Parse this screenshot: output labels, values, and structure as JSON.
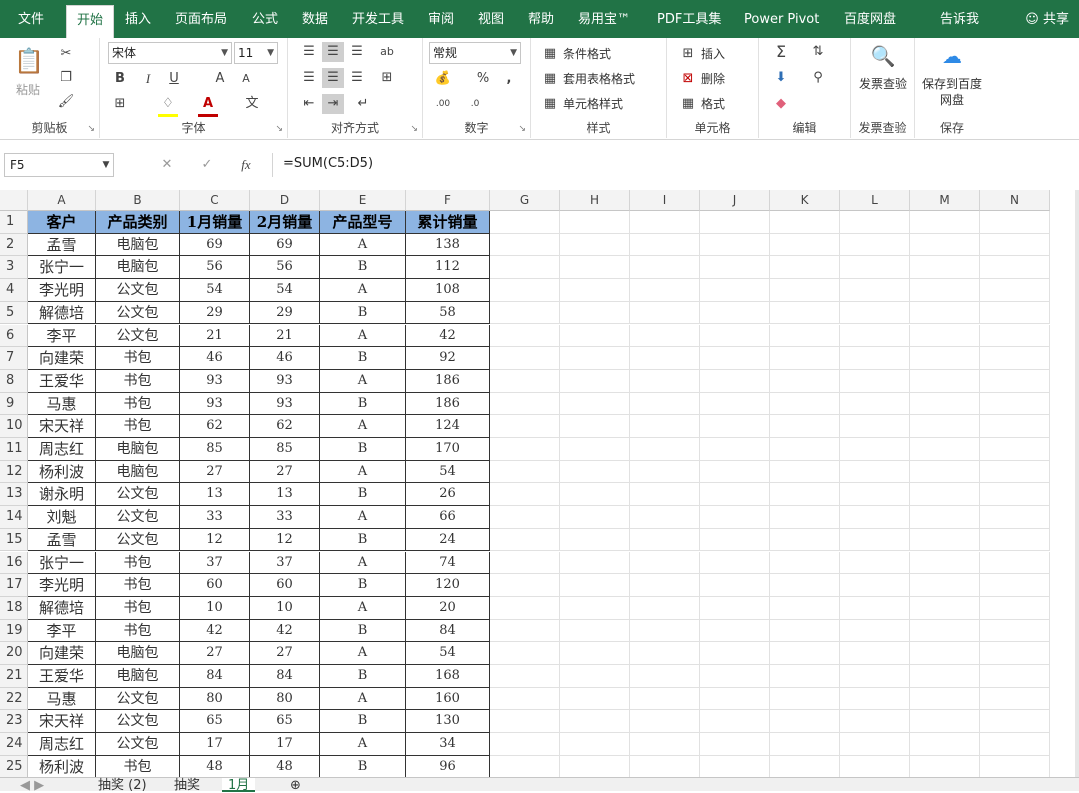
{
  "menu": {
    "tabs": [
      "文件",
      "开始",
      "插入",
      "页面布局",
      "公式",
      "数据",
      "开发工具",
      "审阅",
      "视图",
      "帮助",
      "易用宝™",
      "PDF工具集",
      "Power Pivot",
      "百度网盘",
      "告诉我"
    ],
    "active": "开始",
    "share": "共享"
  },
  "ribbon": {
    "clipboard": {
      "label": "剪贴板",
      "paste": "粘贴"
    },
    "font": {
      "label": "字体",
      "name": "宋体",
      "size": "11",
      "bold": "B",
      "italic": "I",
      "underline": "U",
      "grow": "A",
      "shrink": "A",
      "font_color_glyph": "A",
      "phonetic": "文"
    },
    "alignment": {
      "label": "对齐方式"
    },
    "number": {
      "label": "数字",
      "format": "常规",
      "percent": "%",
      "comma": ","
    },
    "styles": {
      "label": "样式",
      "conditional": "条件格式",
      "table": "套用表格格式",
      "cell": "单元格样式"
    },
    "cells": {
      "label": "单元格",
      "insert": "插入",
      "delete": "删除",
      "format": "格式"
    },
    "editing": {
      "label": "编辑"
    },
    "invoice": {
      "label": "发票查验",
      "button": "发票查验"
    },
    "save": {
      "label": "保存",
      "button": "保存到百度网盘"
    }
  },
  "formula_bar": {
    "name_box": "F5",
    "formula": "=SUM(C5:D5)"
  },
  "grid": {
    "columns": [
      "A",
      "B",
      "C",
      "D",
      "E",
      "F",
      "G",
      "H",
      "I",
      "J",
      "K",
      "L",
      "M",
      "N"
    ],
    "header_row": [
      "客户",
      "产品类别",
      "1月销量",
      "2月销量",
      "产品型号",
      "累计销量"
    ],
    "rows": [
      [
        "孟雪",
        "电脑包",
        "69",
        "69",
        "A",
        "138"
      ],
      [
        "张宁一",
        "电脑包",
        "56",
        "56",
        "B",
        "112"
      ],
      [
        "李光明",
        "公文包",
        "54",
        "54",
        "A",
        "108"
      ],
      [
        "解德培",
        "公文包",
        "29",
        "29",
        "B",
        "58"
      ],
      [
        "李平",
        "公文包",
        "21",
        "21",
        "A",
        "42"
      ],
      [
        "向建荣",
        "书包",
        "46",
        "46",
        "B",
        "92"
      ],
      [
        "王爱华",
        "书包",
        "93",
        "93",
        "A",
        "186"
      ],
      [
        "马惠",
        "书包",
        "93",
        "93",
        "B",
        "186"
      ],
      [
        "宋天祥",
        "书包",
        "62",
        "62",
        "A",
        "124"
      ],
      [
        "周志红",
        "电脑包",
        "85",
        "85",
        "B",
        "170"
      ],
      [
        "杨利波",
        "电脑包",
        "27",
        "27",
        "A",
        "54"
      ],
      [
        "谢永明",
        "公文包",
        "13",
        "13",
        "B",
        "26"
      ],
      [
        "刘魁",
        "公文包",
        "33",
        "33",
        "A",
        "66"
      ],
      [
        "孟雪",
        "公文包",
        "12",
        "12",
        "B",
        "24"
      ],
      [
        "张宁一",
        "书包",
        "37",
        "37",
        "A",
        "74"
      ],
      [
        "李光明",
        "书包",
        "60",
        "60",
        "B",
        "120"
      ],
      [
        "解德培",
        "书包",
        "10",
        "10",
        "A",
        "20"
      ],
      [
        "李平",
        "书包",
        "42",
        "42",
        "B",
        "84"
      ],
      [
        "向建荣",
        "电脑包",
        "27",
        "27",
        "A",
        "54"
      ],
      [
        "王爱华",
        "电脑包",
        "84",
        "84",
        "B",
        "168"
      ],
      [
        "马惠",
        "公文包",
        "80",
        "80",
        "A",
        "160"
      ],
      [
        "宋天祥",
        "公文包",
        "65",
        "65",
        "B",
        "130"
      ],
      [
        "周志红",
        "公文包",
        "17",
        "17",
        "A",
        "34"
      ],
      [
        "杨利波",
        "书包",
        "48",
        "48",
        "B",
        "96"
      ]
    ],
    "header_fill": "#8db4e2"
  },
  "sheet_tabs": [
    "抽奖 (2)",
    "抽奖",
    "1月"
  ],
  "active_sheet": "1月",
  "colors": {
    "accent": "#217346"
  }
}
